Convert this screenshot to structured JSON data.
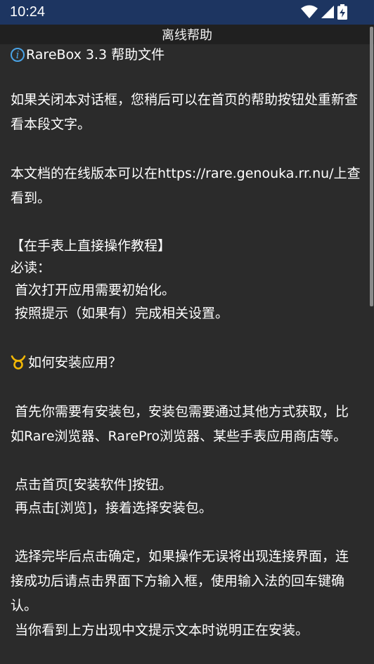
{
  "status_bar": {
    "time": "10:24",
    "icons": [
      "wifi-icon",
      "signal-icon",
      "battery-charging-icon"
    ]
  },
  "title_bar": {
    "title": "离线帮助"
  },
  "content": {
    "header": "RareBox 3.3 帮助文件",
    "header_icon": "info-icon",
    "p1": "如果关闭本对话框，您稍后可以在首页的帮助按钮处重新查看本段文字。",
    "p2": "本文档的在线版本可以在https://rare.genouka.rr.nu/上查看到。",
    "p3_title": "【在手表上直接操作教程】",
    "p3_line1": "必读：",
    "p3_line2": " 首次打开应用需要初始化。",
    "p3_line3": " 按照提示（如果有）完成相关设置。",
    "q1": "如何安装应用？",
    "q1_icon": "taurus-icon",
    "p4": " 首先你需要有安装包，安装包需要通过其他方式获取，比如Rare浏览器、RarePro浏览器、某些手表应用商店等。",
    "p5_line1": " 点击首页[安装软件]按钮。",
    "p5_line2": " 再点击[浏览]，接着选择安装包。",
    "p6": " 选择完毕后点击确定，如果操作无误将出现连接界面，连接成功后请点击界面下方输入框，使用输入法的回车键确认。",
    "p7": " 当你看到上方出现中文提示文本时说明正在安装。"
  },
  "colors": {
    "status_bar": "#1d3561",
    "title_bar": "#202020",
    "background": "#2b2b2b",
    "info_icon": "#4aa3e6",
    "taurus_icon": "#f2b705"
  }
}
